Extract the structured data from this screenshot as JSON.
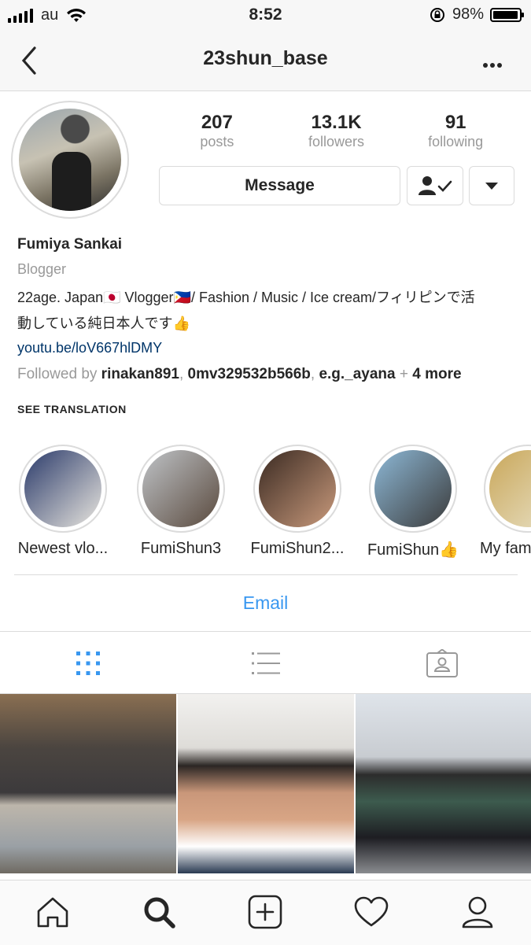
{
  "status_bar": {
    "carrier": "au",
    "time": "8:52",
    "battery": "98%",
    "battery_level": 0.98
  },
  "nav": {
    "title": "23shun_base",
    "back_icon": "chevron-left-icon",
    "more_icon": "more-dots-icon"
  },
  "stats": [
    {
      "value": "207",
      "label": "posts"
    },
    {
      "value": "13.1K",
      "label": "followers"
    },
    {
      "value": "91",
      "label": "following"
    }
  ],
  "buttons": {
    "message": "Message"
  },
  "bio": {
    "name": "Fumiya Sankai",
    "category": "Blogger",
    "line1": "22age. Japan🇯🇵 Vlogger🇵🇭/ Fashion / Music / Ice cream/フィリピンで活",
    "line2": "動している純日本人です👍",
    "link": "youtu.be/loV667hlDMY",
    "followed_by_prefix": "Followed by",
    "followers": [
      "rinakan891",
      "0mv329532b566b",
      "e.g._ayana"
    ],
    "more": "4 more"
  },
  "see_translation": "SEE TRANSLATION",
  "highlights": [
    {
      "label": "Newest vlo...",
      "colors": [
        "#2a3a6a",
        "#e9e6df"
      ]
    },
    {
      "label": "FumiShun3",
      "colors": [
        "#bfc3c7",
        "#5a4a3e"
      ]
    },
    {
      "label": "FumiShun2...",
      "colors": [
        "#3a2a22",
        "#c99a7c"
      ]
    },
    {
      "label": "FumiShun👍",
      "colors": [
        "#8db8d6",
        "#3b3b3b"
      ]
    },
    {
      "label": "My fam",
      "colors": [
        "#c9a75a",
        "#e9e2c8"
      ]
    }
  ],
  "email": "Email",
  "accent": "#3897f0"
}
